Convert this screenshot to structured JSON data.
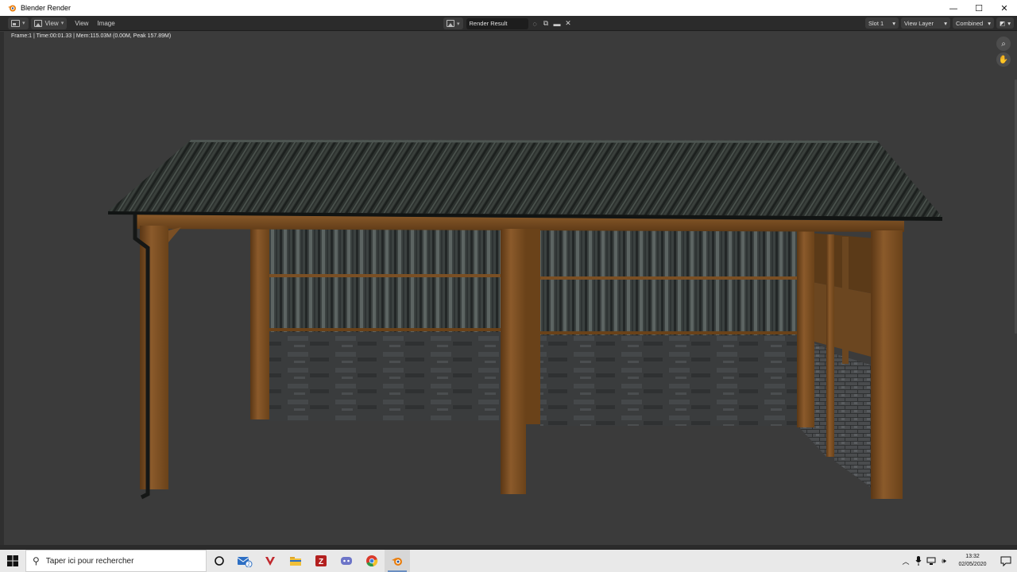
{
  "window": {
    "title": "Blender Render",
    "app_icon": "blender-logo-icon",
    "minimize": "—",
    "maximize": "☐",
    "close": "✕"
  },
  "header": {
    "editor_type_icon": "image-editor-icon",
    "view_menu_icon": "image-icon",
    "view_dropdown": "View",
    "menu_view": "View",
    "menu_image": "Image",
    "image_name": "Render Result",
    "slot": "Slot 1",
    "view_layer": "View Layer",
    "pass": "Combined"
  },
  "viewport": {
    "render_info": "Frame:1 | Time:00:01.33 | Mem:115.03M (0.00M, Peak 157.89M)",
    "zoom_icon": "magnifier-icon",
    "pan_icon": "hand-icon"
  },
  "taskbar": {
    "search_placeholder": "Taper ici pour rechercher",
    "apps": [
      "cortana-icon",
      "mail-icon",
      "vivaldi-icon",
      "file-explorer-icon",
      "filezilla-icon",
      "discord-icon",
      "chrome-icon",
      "blender-icon"
    ],
    "mail_badge": "2",
    "time": "13:32",
    "date": "02/05/2020"
  },
  "colors": {
    "blender_bg": "#3b3b3b",
    "header_bg": "#2b2b2b",
    "taskbar_bg": "#e9e9e9",
    "wood": "#7a4f24",
    "roof": "#2b302d",
    "blender_orange": "#e87d0d"
  }
}
